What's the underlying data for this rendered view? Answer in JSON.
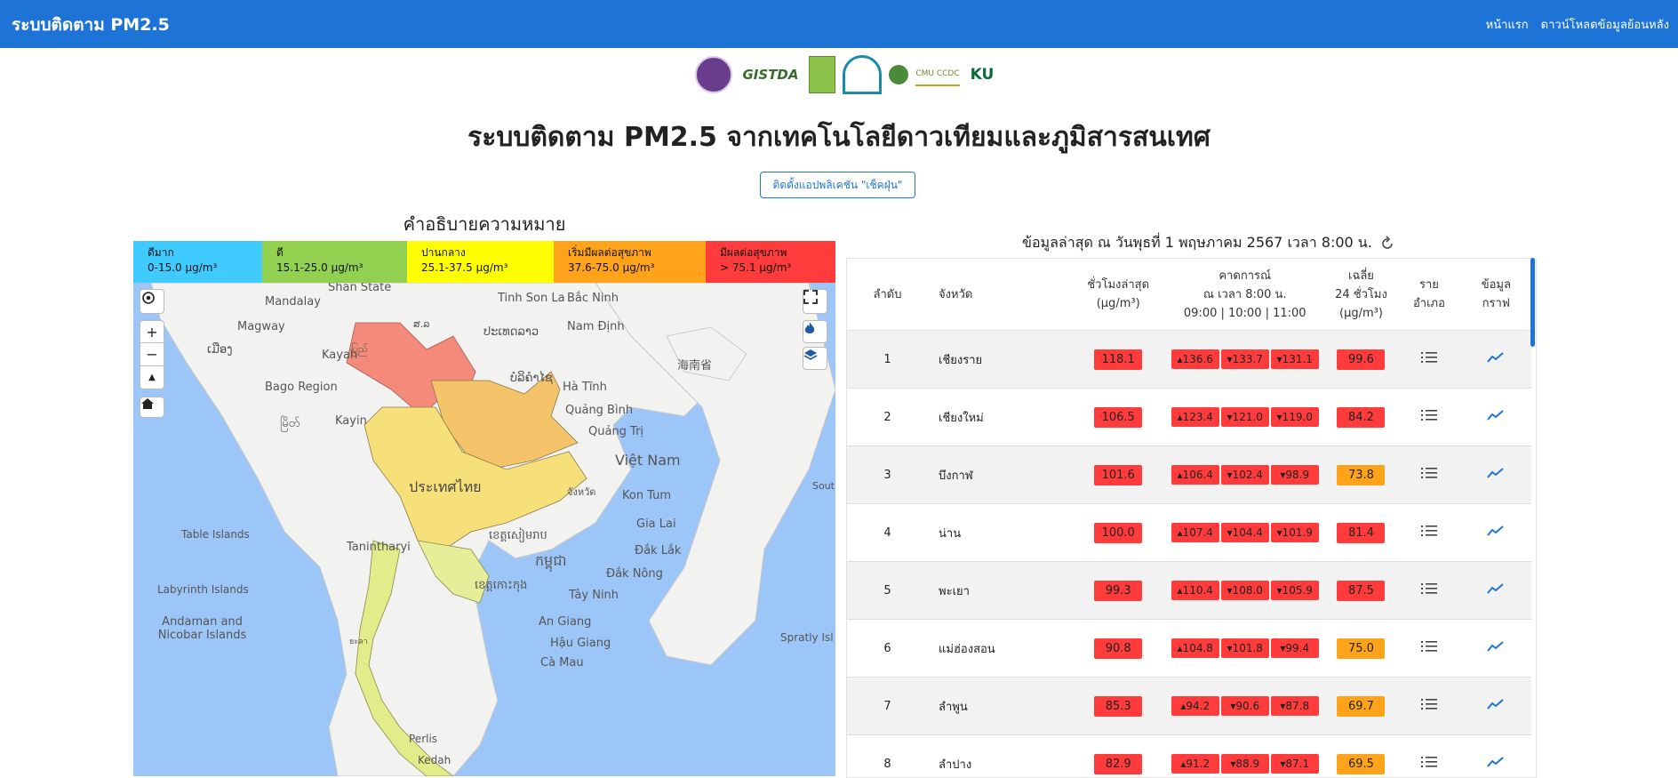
{
  "navbar": {
    "brand": "ระบบติดตาม PM2.5",
    "links": [
      "หน้าแรก",
      "ดาวน์โหลดข้อมูลย้อนหลัง"
    ]
  },
  "logos": {
    "gistda": "GISTDA",
    "cmu": "CMU CCDC",
    "ku": "KU"
  },
  "page_title": "ระบบติดตาม PM2.5 จากเทคโนโลยีดาวเทียมและภูมิสารสนเทศ",
  "app_button": "ติดตั้งแอปพลิเคชัน \"เช็คฝุ่น\"",
  "legend": {
    "title": "คำอธิบายความหมาย",
    "items": [
      {
        "label": "ดีมาก",
        "range": "0-15.0 µg/m³",
        "color": "#3fcbff"
      },
      {
        "label": "ดี",
        "range": "15.1-25.0 µg/m³",
        "color": "#92d050"
      },
      {
        "label": "ปานกลาง",
        "range": "25.1-37.5 µg/m³",
        "color": "#ffff00"
      },
      {
        "label": "เริ่มมีผลต่อสุขภาพ",
        "range": "37.6-75.0 µg/m³",
        "color": "#ffa31a"
      },
      {
        "label": "มีผลต่อสุขภาพ",
        "range": "> 75.1 µg/m³",
        "color": "#ff3b3b"
      }
    ]
  },
  "map_labels": [
    "Shan State",
    "Mandalay",
    "Magway",
    "ເມືອງ",
    "Kayah",
    "Bago Region",
    "Kayin",
    "Tinh Son La",
    "Bắc Ninh",
    "ປະເທດລາວ",
    "Nam Định",
    "海南省",
    "ບໍລິຄໍາໄຊ",
    "Hà Tĩnh",
    "Quảng Bình",
    "Quảng Trị",
    "Việt Nam",
    "ประเทศไทย",
    "จังหวัด",
    "Kon Tum",
    "Gia Lai",
    "Đắk Lắk",
    "Đắk Nông",
    "Tây Ninh",
    "Table Islands",
    "Tanintharyi",
    "ខេត្តសៀមរាប",
    "កម្ពុជា",
    "ខេត្តកោះកុង",
    "Labyrinth Islands",
    "Andaman and Nicobar Islands",
    "An Giang",
    "Hậu Giang",
    "Cà Mau",
    "Spratly Isl",
    "Perlis",
    "Kedah",
    "South",
    "မြိတ်",
    "ยะลา",
    "ສ.ລ",
    "ပြည်"
  ],
  "updated": "ข้อมูลล่าสุด ณ วันพุธที่ 1 พฤษภาคม 2567 เวลา 8:00 น.",
  "table": {
    "headers": {
      "rank": "ลำดับ",
      "province": "จังหวัด",
      "latest": [
        "ชั่วโมงล่าสุด",
        "(µg/m³)"
      ],
      "forecast": [
        "คาดการณ์",
        "ณ เวลา 8:00 น.",
        "09:00 | 10:00 | 11:00"
      ],
      "avg": [
        "เฉลี่ย",
        "24 ชั่วโมง",
        "(µg/m³)"
      ],
      "district": [
        "ราย",
        "อำเภอ"
      ],
      "graph": [
        "ข้อมูล",
        "กราฟ"
      ]
    },
    "rows": [
      {
        "rank": "1",
        "province": "เชียงราย",
        "latest": "118.1",
        "f1": "▴136.6",
        "f2": "▾133.7",
        "f3": "▾131.1",
        "avg": "99.6",
        "avg_level": "red"
      },
      {
        "rank": "2",
        "province": "เชียงใหม่",
        "latest": "106.5",
        "f1": "▴123.4",
        "f2": "▾121.0",
        "f3": "▾119.0",
        "avg": "84.2",
        "avg_level": "red"
      },
      {
        "rank": "3",
        "province": "บึงกาฬ",
        "latest": "101.6",
        "f1": "▴106.4",
        "f2": "▾102.4",
        "f3": "▾98.9",
        "avg": "73.8",
        "avg_level": "orange"
      },
      {
        "rank": "4",
        "province": "น่าน",
        "latest": "100.0",
        "f1": "▴107.4",
        "f2": "▾104.4",
        "f3": "▾101.9",
        "avg": "81.4",
        "avg_level": "red"
      },
      {
        "rank": "5",
        "province": "พะเยา",
        "latest": "99.3",
        "f1": "▴110.4",
        "f2": "▾108.0",
        "f3": "▾105.9",
        "avg": "87.5",
        "avg_level": "red"
      },
      {
        "rank": "6",
        "province": "แม่ฮ่องสอน",
        "latest": "90.8",
        "f1": "▴104.8",
        "f2": "▾101.8",
        "f3": "▾99.4",
        "avg": "75.0",
        "avg_level": "orange"
      },
      {
        "rank": "7",
        "province": "ลำพูน",
        "latest": "85.3",
        "f1": "▴94.2",
        "f2": "▾90.6",
        "f3": "▾87.8",
        "avg": "69.7",
        "avg_level": "orange"
      },
      {
        "rank": "8",
        "province": "ลำปาง",
        "latest": "82.9",
        "f1": "▴91.2",
        "f2": "▾88.9",
        "f3": "▾87.1",
        "avg": "69.5",
        "avg_level": "orange"
      }
    ]
  },
  "colors": {
    "primary": "#1e74d6",
    "red": "#ff3b3b",
    "orange": "#ffa31a"
  }
}
